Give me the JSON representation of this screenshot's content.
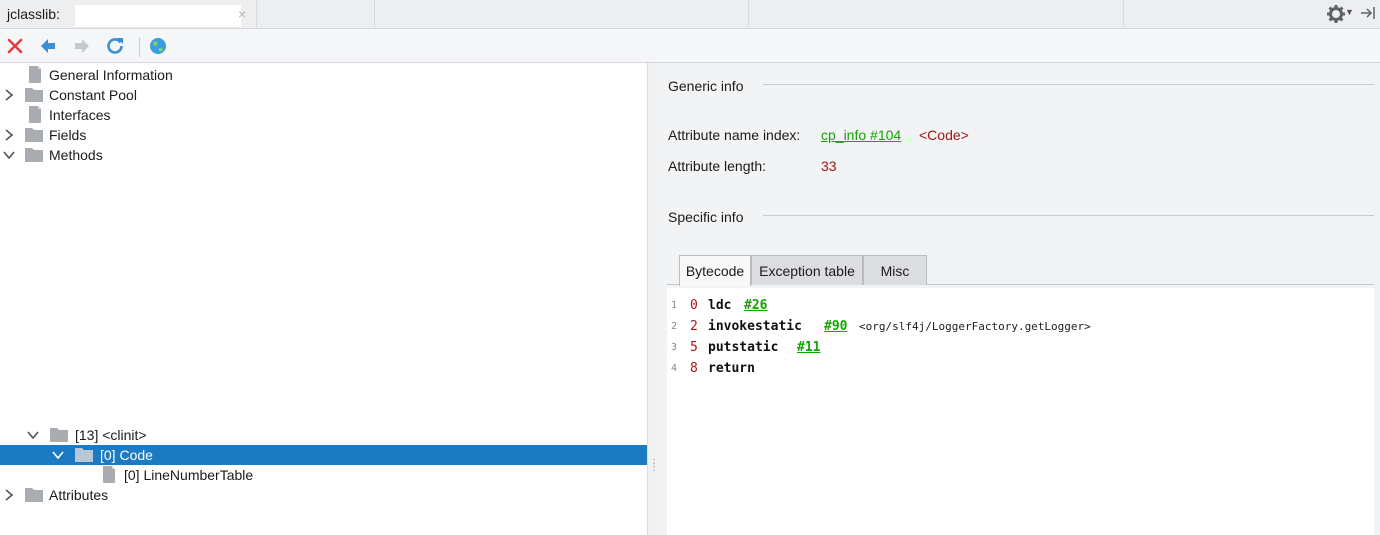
{
  "app": {
    "title": "jclasslib:"
  },
  "toolbar": {
    "buttons": [
      "close-icon",
      "back-icon",
      "forward-icon",
      "refresh-icon",
      "web-icon"
    ]
  },
  "tree": {
    "items": [
      {
        "label": "General Information",
        "type": "file"
      },
      {
        "label": "Constant Pool",
        "type": "folder",
        "expandable": true,
        "expanded": false
      },
      {
        "label": "Interfaces",
        "type": "file"
      },
      {
        "label": "Fields",
        "type": "folder",
        "expandable": true,
        "expanded": false
      },
      {
        "label": "Methods",
        "type": "folder",
        "expandable": true,
        "expanded": true
      },
      {
        "label": "[13] <clinit>",
        "type": "folder",
        "expandable": true,
        "expanded": true
      },
      {
        "label": "[0] Code",
        "type": "folder",
        "expandable": true,
        "expanded": true,
        "selected": true
      },
      {
        "label": "[0] LineNumberTable",
        "type": "file"
      },
      {
        "label": "Attributes",
        "type": "folder",
        "expandable": true,
        "expanded": false
      }
    ]
  },
  "details": {
    "generic_title": "Generic info",
    "attr_name_label": "Attribute name index:",
    "attr_name_link": "cp_info #104",
    "attr_name_value": "<Code>",
    "attr_length_label": "Attribute length:",
    "attr_length_value": "33",
    "specific_title": "Specific info",
    "tabs": [
      "Bytecode",
      "Exception table",
      "Misc"
    ],
    "bytecode": [
      {
        "line": "1",
        "offset": "0",
        "op": "ldc",
        "arg": "#26",
        "comment": ""
      },
      {
        "line": "2",
        "offset": "2",
        "op": "invokestatic",
        "arg": "#90",
        "comment": "<org/slf4j/LoggerFactory.getLogger>"
      },
      {
        "line": "3",
        "offset": "5",
        "op": "putstatic",
        "arg": "#11",
        "comment": ""
      },
      {
        "line": "4",
        "offset": "8",
        "op": "return",
        "arg": "",
        "comment": ""
      }
    ]
  },
  "colors": {
    "selection": "#1b7ac2",
    "link": "#12a600",
    "value": "#a31515"
  }
}
